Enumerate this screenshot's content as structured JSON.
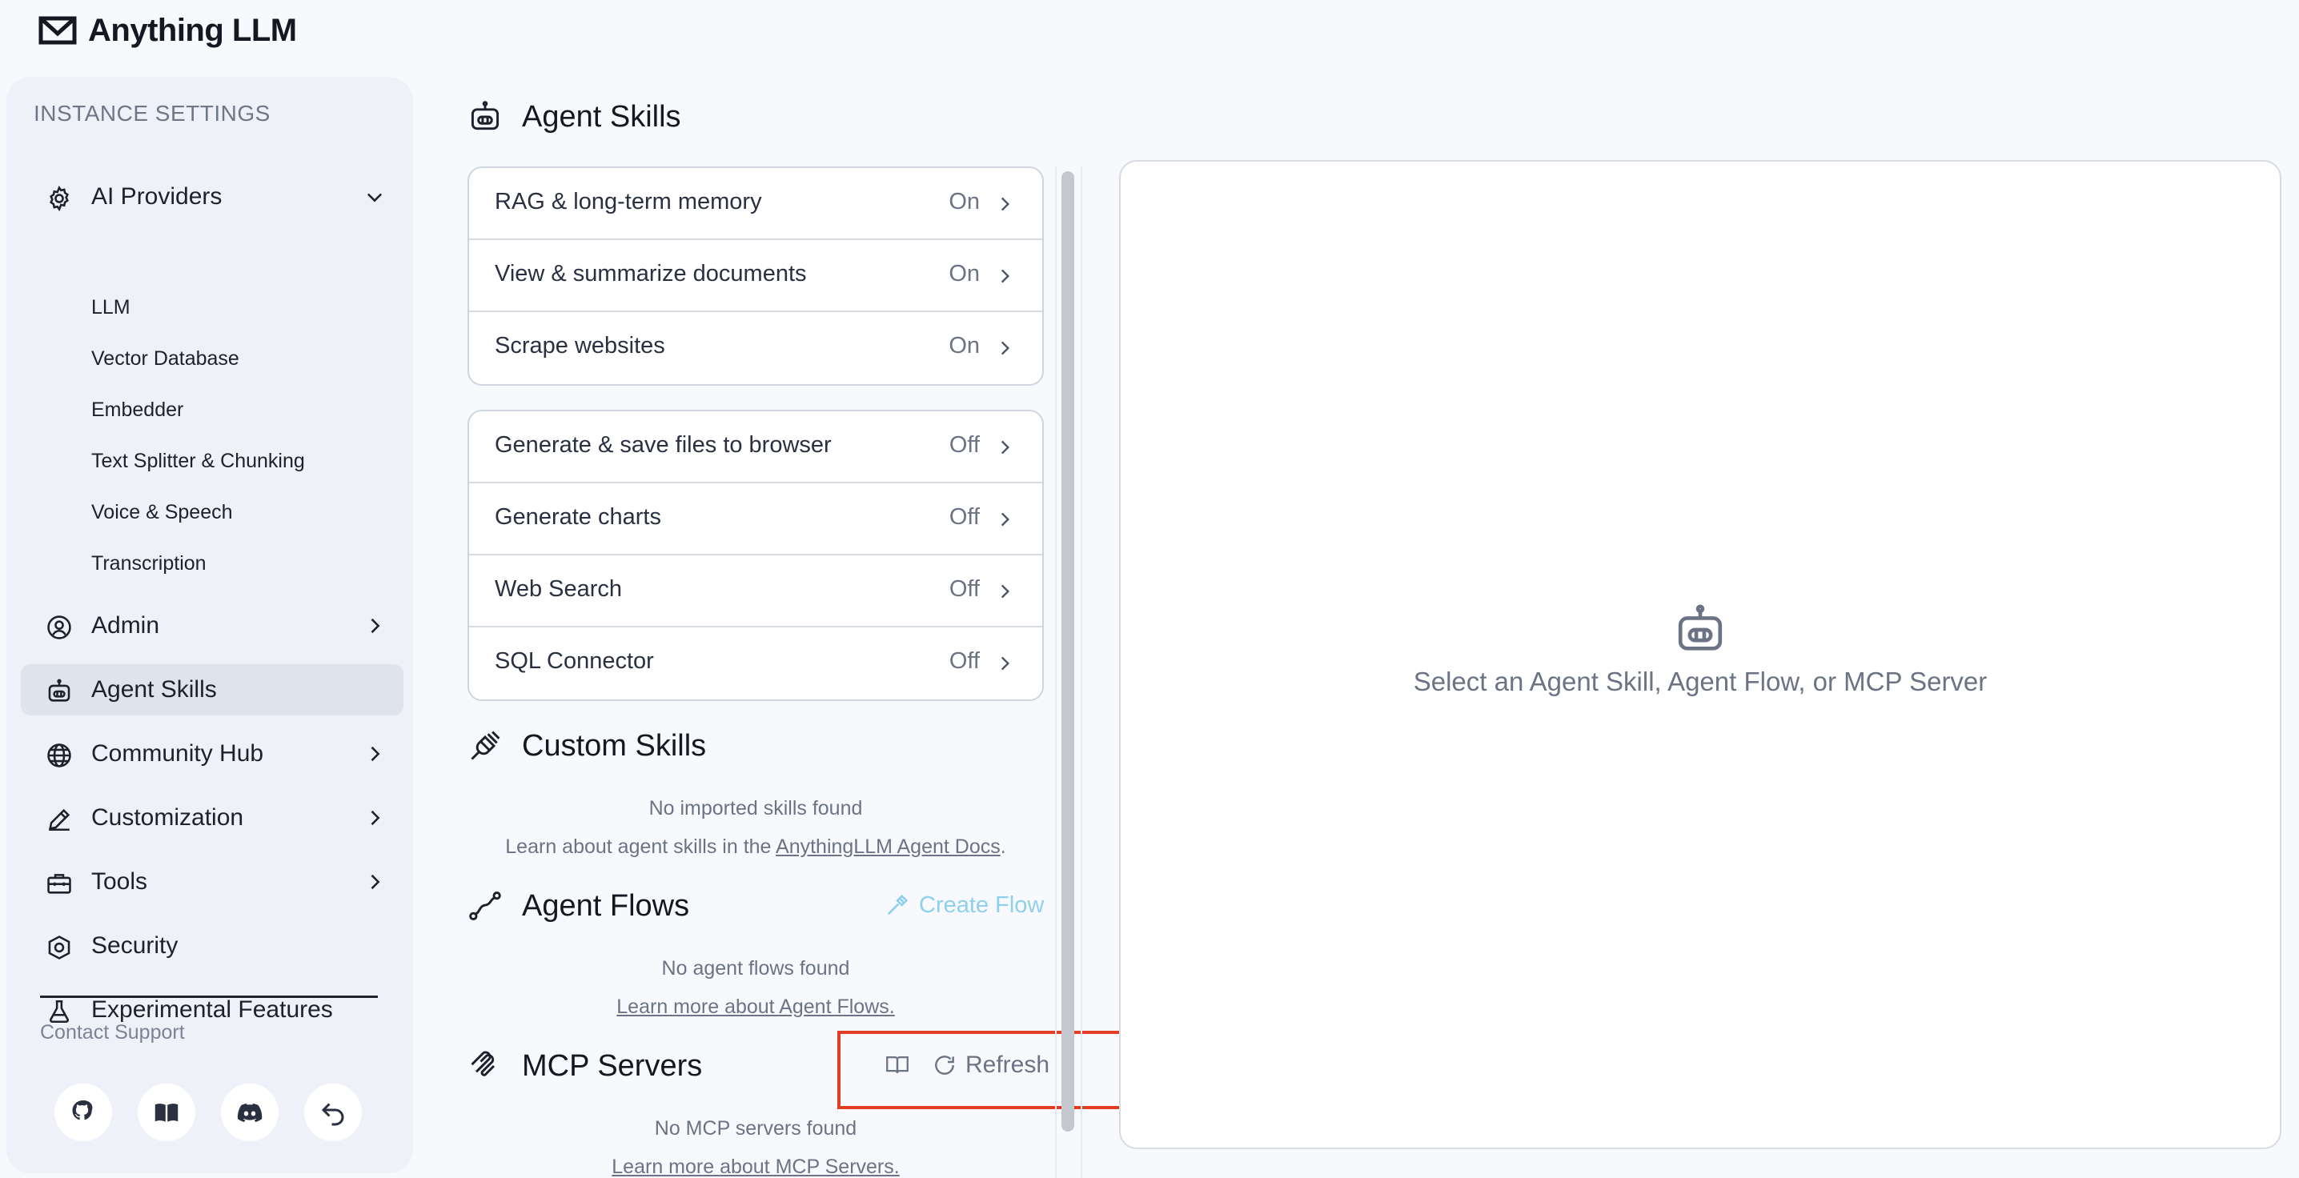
{
  "app": {
    "name": "Anything LLM"
  },
  "sidebar": {
    "section_title": "INSTANCE SETTINGS",
    "ai_providers": {
      "label": "AI Providers",
      "subitems": [
        "LLM",
        "Vector Database",
        "Embedder",
        "Text Splitter & Chunking",
        "Voice & Speech",
        "Transcription"
      ]
    },
    "items": [
      {
        "label": "Admin"
      },
      {
        "label": "Agent Skills"
      },
      {
        "label": "Community Hub"
      },
      {
        "label": "Customization"
      },
      {
        "label": "Tools"
      },
      {
        "label": "Security"
      },
      {
        "label": "Experimental Features"
      }
    ],
    "contact_support": "Contact Support"
  },
  "main": {
    "title": "Agent Skills",
    "default_skills": [
      {
        "name": "RAG & long-term memory",
        "status": "On"
      },
      {
        "name": "View & summarize documents",
        "status": "On"
      },
      {
        "name": "Scrape websites",
        "status": "On"
      }
    ],
    "optional_skills": [
      {
        "name": "Generate & save files to browser",
        "status": "Off"
      },
      {
        "name": "Generate charts",
        "status": "Off"
      },
      {
        "name": "Web Search",
        "status": "Off"
      },
      {
        "name": "SQL Connector",
        "status": "Off"
      }
    ],
    "custom_skills": {
      "title": "Custom Skills",
      "empty": "No imported skills found",
      "learn_prefix": "Learn about agent skills in the ",
      "learn_link": "AnythingLLM Agent Docs",
      "learn_suffix": "."
    },
    "agent_flows": {
      "title": "Agent Flows",
      "create_label": "Create Flow",
      "empty": "No agent flows found",
      "learn_link": "Learn more about Agent Flows."
    },
    "mcp_servers": {
      "title": "MCP Servers",
      "refresh_label": "Refresh",
      "empty": "No MCP servers found",
      "learn_link": "Learn more about MCP Servers."
    }
  },
  "detail": {
    "placeholder": "Select an Agent Skill, Agent Flow, or MCP Server"
  },
  "colors": {
    "accent_link": "#8fd0ee",
    "highlight": "#e43d26"
  }
}
